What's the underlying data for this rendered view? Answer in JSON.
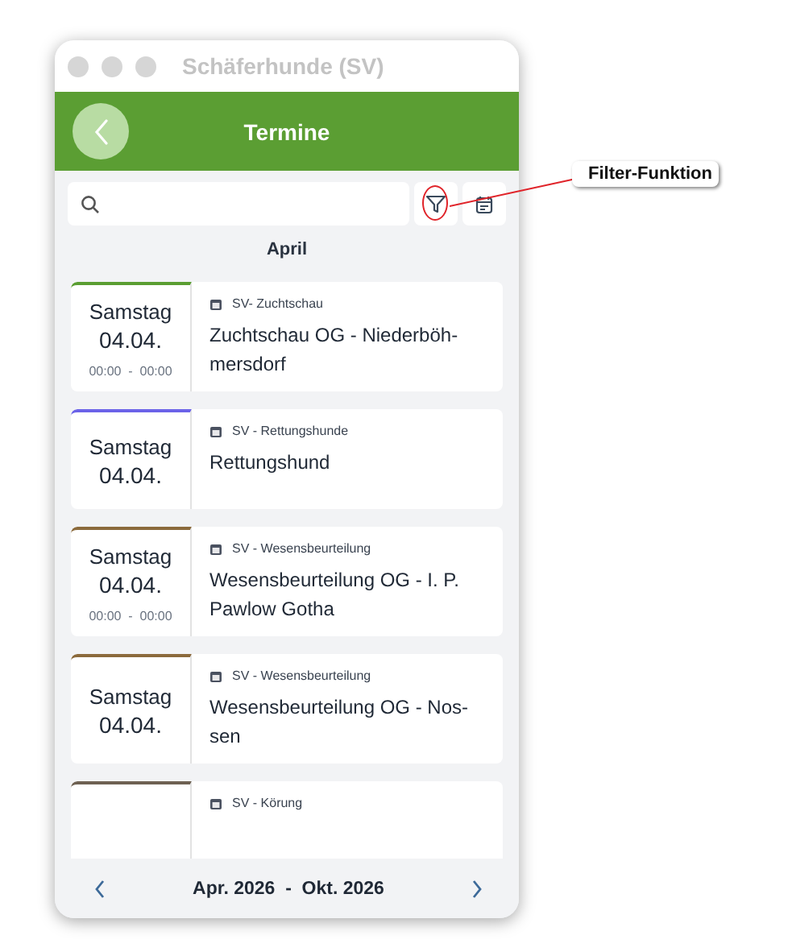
{
  "window": {
    "title": "Schäferhunde (SV)"
  },
  "header": {
    "title": "Termine"
  },
  "filter_highlighted": true,
  "callout": {
    "text": "Filter-Funktion"
  },
  "month": "April",
  "events": [
    {
      "weekday": "Samstag",
      "date": "04.04.",
      "time": "00:00  -  00:00",
      "category": "SV- Zuchtschau",
      "title": "Zuchtschau OG - Niederböh-mersdorf",
      "color": "#5a9e32"
    },
    {
      "weekday": "Samstag",
      "date": "04.04.",
      "category": "SV - Rettungshunde",
      "title": "Rettungshund",
      "color": "#6b63e8"
    },
    {
      "weekday": "Samstag",
      "date": "04.04.",
      "time": "00:00  -  00:00",
      "category": "SV - Wesensbeurteilung",
      "title": "Wesensbeurteilung OG - I. P. Pawlow Gotha",
      "color": "#8b6a3c"
    },
    {
      "weekday": "Samstag",
      "date": "04.04.",
      "category": "SV - Wesensbeurteilung",
      "title": "Wesensbeurteilung OG - Nos-sen",
      "color": "#8b6a3c"
    },
    {
      "category": "SV - Körung",
      "color": "#6e6152"
    }
  ],
  "footer": {
    "range_start": "Apr. 2026",
    "separator": "-",
    "range_end": "Okt. 2026"
  }
}
